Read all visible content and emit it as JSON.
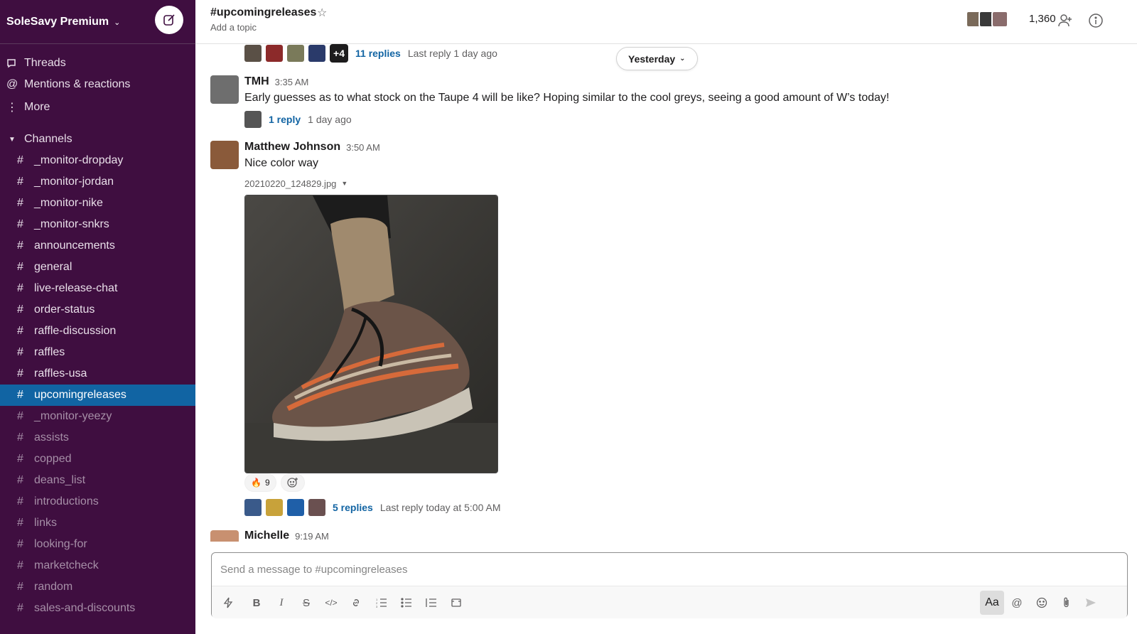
{
  "workspace": {
    "name": "SoleSavy Premium",
    "nav": [
      {
        "label": "Threads"
      },
      {
        "label": "Mentions & reactions"
      },
      {
        "label": "More"
      }
    ],
    "channels_header": "Channels",
    "channels": [
      {
        "name": "_monitor-dropday",
        "muted": false,
        "active": false
      },
      {
        "name": "_monitor-jordan",
        "muted": false,
        "active": false
      },
      {
        "name": "_monitor-nike",
        "muted": false,
        "active": false
      },
      {
        "name": "_monitor-snkrs",
        "muted": false,
        "active": false
      },
      {
        "name": "announcements",
        "muted": false,
        "active": false
      },
      {
        "name": "general",
        "muted": false,
        "active": false
      },
      {
        "name": "live-release-chat",
        "muted": false,
        "active": false
      },
      {
        "name": "order-status",
        "muted": false,
        "active": false
      },
      {
        "name": "raffle-discussion",
        "muted": false,
        "active": false
      },
      {
        "name": "raffles",
        "muted": false,
        "active": false
      },
      {
        "name": "raffles-usa",
        "muted": false,
        "active": false
      },
      {
        "name": "upcomingreleases",
        "muted": false,
        "active": true
      },
      {
        "name": "_monitor-yeezy",
        "muted": true,
        "active": false
      },
      {
        "name": "assists",
        "muted": true,
        "active": false
      },
      {
        "name": "copped",
        "muted": true,
        "active": false
      },
      {
        "name": "deans_list",
        "muted": true,
        "active": false
      },
      {
        "name": "introductions",
        "muted": true,
        "active": false
      },
      {
        "name": "links",
        "muted": true,
        "active": false
      },
      {
        "name": "looking-for",
        "muted": true,
        "active": false
      },
      {
        "name": "marketcheck",
        "muted": true,
        "active": false
      },
      {
        "name": "random",
        "muted": true,
        "active": false
      },
      {
        "name": "sales-and-discounts",
        "muted": true,
        "active": false
      }
    ],
    "hash": "#"
  },
  "header": {
    "channel": "#upcomingreleases",
    "topic": "Add a topic",
    "member_count": "1,360"
  },
  "date_divider": "Yesterday",
  "thread_top": {
    "extra_count": "+4",
    "replies": "11 replies",
    "last_reply": "Last reply 1 day ago"
  },
  "messages": [
    {
      "sender": "TMH",
      "time": "3:35 AM",
      "text": "Early guesses as to what stock on the Taupe 4 will be like? Hoping similar to the cool greys, seeing a good amount of W’s today!",
      "replies": "1 reply",
      "last_reply": "1 day ago"
    },
    {
      "sender": "Matthew Johnson",
      "time": "3:50 AM",
      "text": "Nice color way",
      "file_name": "20210220_124829.jpg",
      "reaction_emoji": "🔥",
      "reaction_count": "9",
      "replies": "5 replies",
      "last_reply": "Last reply today at 5:00 AM"
    },
    {
      "sender": "Michelle",
      "time": "9:19 AM"
    }
  ],
  "composer": {
    "placeholder": "Send a message to #upcomingreleases",
    "format_label": "Aa"
  },
  "colors": {
    "sidebar_bg": "#3f0e40",
    "active_channel": "#1164a3",
    "link": "#1264a3"
  }
}
